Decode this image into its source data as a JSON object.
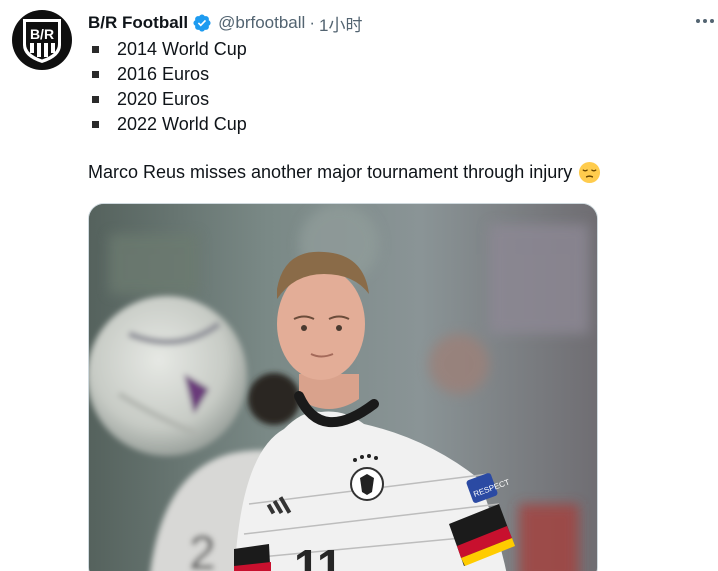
{
  "account": {
    "avatar_icon": "bleacher-report-shield-logo",
    "avatar_logo_text": "B/R",
    "display_name": "B/R Football",
    "verified_icon": "verified-badge-icon",
    "handle": "@brfootball",
    "separator": "·",
    "time": "1小时"
  },
  "tweet": {
    "bullets": [
      "2014 World Cup",
      "2016 Euros",
      "2020 Euros",
      "2022 World Cup"
    ],
    "text": "Marco Reus misses another major tournament through injury",
    "emoji_icon": "pensive-face-emoji",
    "more_icon": "more-horizontal-icon"
  },
  "media": {
    "jersey_number": "11",
    "sleeve_badge": "RESPECT",
    "kit_brand_icon": "adidas-logo",
    "crest_icon": "german-eagle-crest"
  },
  "colors": {
    "verified": "#1d9bf0",
    "text_primary": "#0f1419",
    "text_secondary": "#536471"
  }
}
